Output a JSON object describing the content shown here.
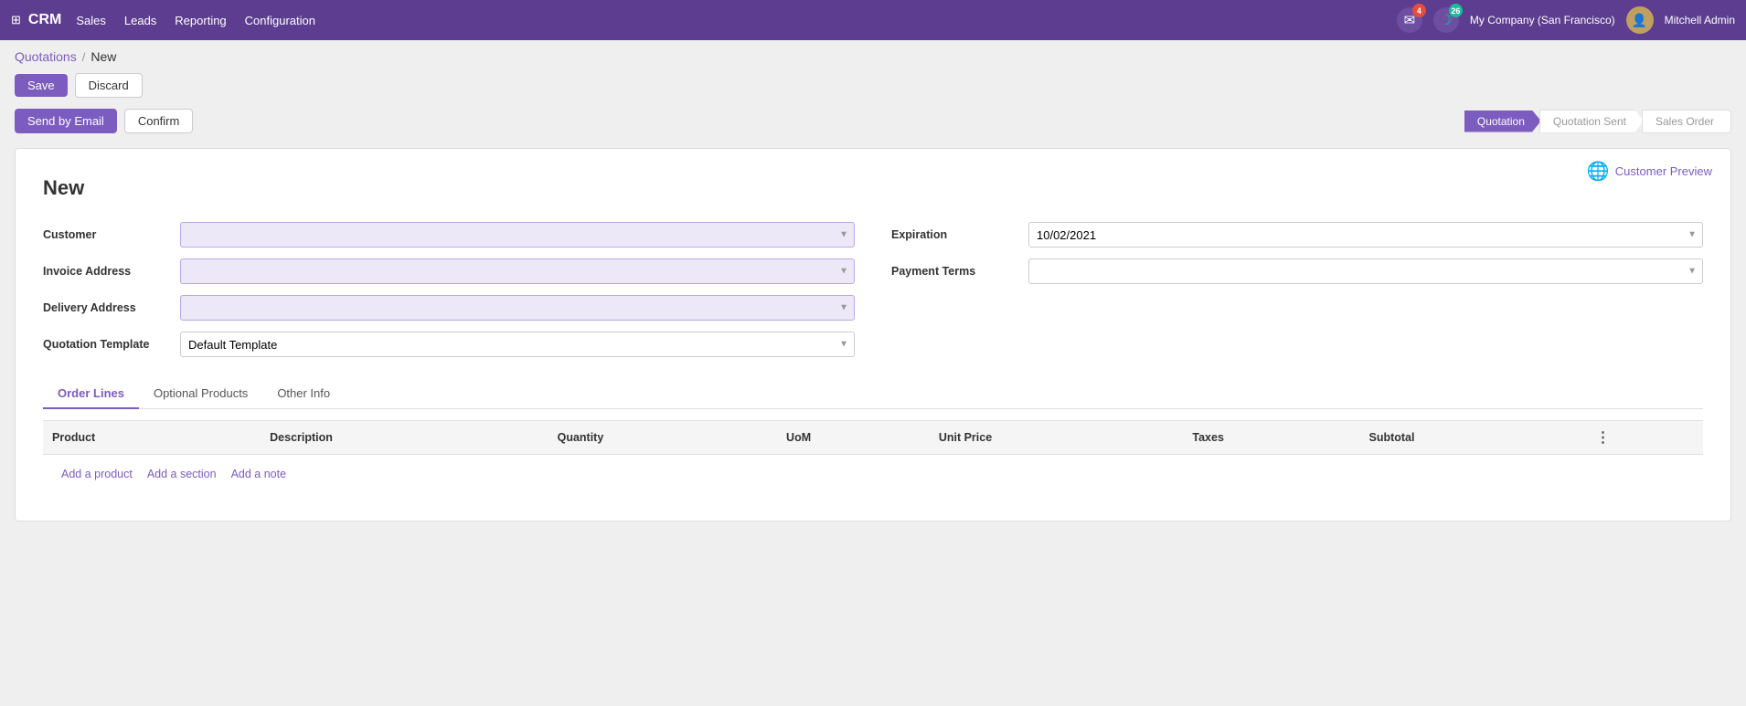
{
  "app": {
    "name": "CRM",
    "grid_icon": "⊞"
  },
  "nav": {
    "links": [
      "Sales",
      "Leads",
      "Reporting",
      "Configuration"
    ]
  },
  "topbar": {
    "message_badge": "4",
    "activity_badge": "26",
    "company": "My Company (San Francisco)",
    "user": "Mitchell Admin"
  },
  "breadcrumb": {
    "parent": "Quotations",
    "current": "New",
    "separator": "/"
  },
  "actions": {
    "save": "Save",
    "discard": "Discard",
    "send_email": "Send by Email",
    "confirm": "Confirm"
  },
  "pipeline": {
    "steps": [
      "Quotation",
      "Quotation Sent",
      "Sales Order"
    ],
    "active_index": 0
  },
  "customer_preview": {
    "label": "Customer Preview",
    "icon": "🌐"
  },
  "form": {
    "title": "New",
    "fields": {
      "customer_label": "Customer",
      "invoice_address_label": "Invoice Address",
      "delivery_address_label": "Delivery Address",
      "quotation_template_label": "Quotation Template",
      "quotation_template_value": "Default Template",
      "expiration_label": "Expiration",
      "expiration_value": "10/02/2021",
      "payment_terms_label": "Payment Terms"
    }
  },
  "tabs": {
    "items": [
      "Order Lines",
      "Optional Products",
      "Other Info"
    ],
    "active": "Order Lines"
  },
  "table": {
    "columns": [
      "Product",
      "Description",
      "Quantity",
      "UoM",
      "Unit Price",
      "Taxes",
      "Subtotal"
    ],
    "add_product": "Add a product",
    "add_section": "Add a section",
    "add_note": "Add a note"
  }
}
